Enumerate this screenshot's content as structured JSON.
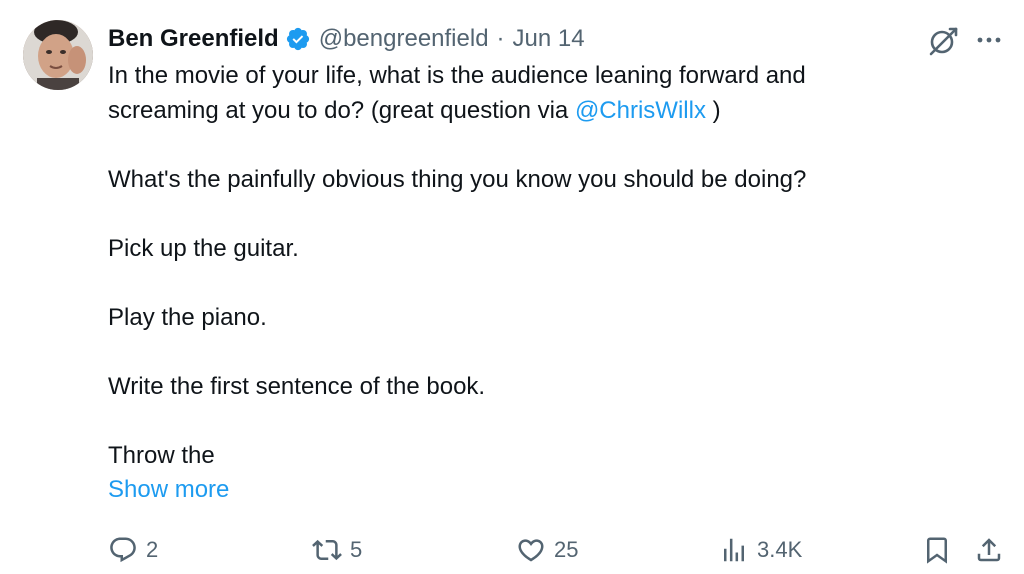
{
  "author": {
    "name": "Ben Greenfield",
    "handle": "@bengreenfield",
    "separator": "·",
    "date": "Jun 14"
  },
  "tweet": {
    "line1": "In the movie of your life, what is the audience leaning forward and",
    "line2_prefix": "screaming at you to do? (great question via ",
    "mention": "@ChrisWillx",
    "line2_suffix": " )",
    "p2": "What's the painfully obvious thing you know you should be doing?",
    "p3": "Pick up the guitar.",
    "p4": "Play the piano.",
    "p5": "Write the first sentence of the book.",
    "p6": "Throw the",
    "show_more": "Show more"
  },
  "actions": {
    "replies": "2",
    "reposts": "5",
    "likes": "25",
    "views": "3.4K"
  },
  "icons": [
    "avatar",
    "verified-badge-icon",
    "grok-icon",
    "more-icon",
    "reply-icon",
    "retweet-icon",
    "like-icon",
    "views-icon",
    "bookmark-icon",
    "share-icon"
  ],
  "colors": {
    "text": "#0f1419",
    "secondary": "#536471",
    "link": "#1d9bf0",
    "verified": "#1d9bf0"
  }
}
